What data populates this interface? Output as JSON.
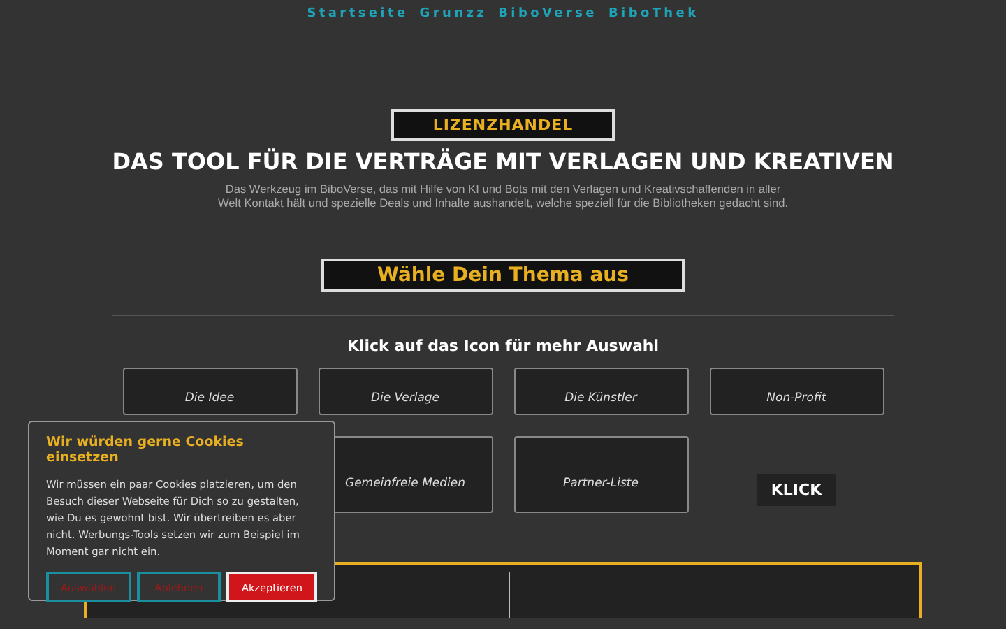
{
  "nav": [
    "Startseite",
    "Grunzz",
    "BiboVerse",
    "BiboThek"
  ],
  "badge": "LIZENZHANDEL",
  "title": "DAS TOOL FÜR DIE VERTRÄGE MIT VERLAGEN UND KREATIVEN",
  "intro": "Das Werkzeug im BiboVerse, das mit Hilfe von KI und Bots mit den Verlagen und Kreativschaffenden in aller Welt Kontakt hält und spezielle Deals und Inhalte aushandelt, welche speziell für die Bibliotheken gedacht sind.",
  "theme_heading": "Wähle Dein Thema aus",
  "subheading": "Klick auf das Icon für mehr Auswahl",
  "tiles_row_1": [
    {
      "label": "Die Idee"
    },
    {
      "label": "Die Verlage"
    },
    {
      "label": "Die Künstler"
    },
    {
      "label": "Non-Profit"
    }
  ],
  "tiles_row_2": [
    {
      "kind": "tile",
      "label": "Gemeinfreie Medien"
    },
    {
      "kind": "tile",
      "label": "Partner-Liste"
    },
    {
      "kind": "button",
      "label": "KLICK"
    }
  ],
  "cookie": {
    "title": "Wir würden gerne Cookies einsetzen",
    "text": "Wir müssen ein paar Cookies platzieren, um den Besuch dieser Webseite für Dich so zu gestalten, wie Du es gewohnt bist. Wir übertreiben es aber nicht. Werbungs-Tools setzen wir zum Beispiel im Moment gar nicht ein.",
    "buttons": [
      {
        "label": "Auswählen",
        "kind": "outline"
      },
      {
        "label": "Ablehnen",
        "kind": "outline"
      },
      {
        "label": "Akzeptieren",
        "kind": "primary"
      }
    ]
  }
}
